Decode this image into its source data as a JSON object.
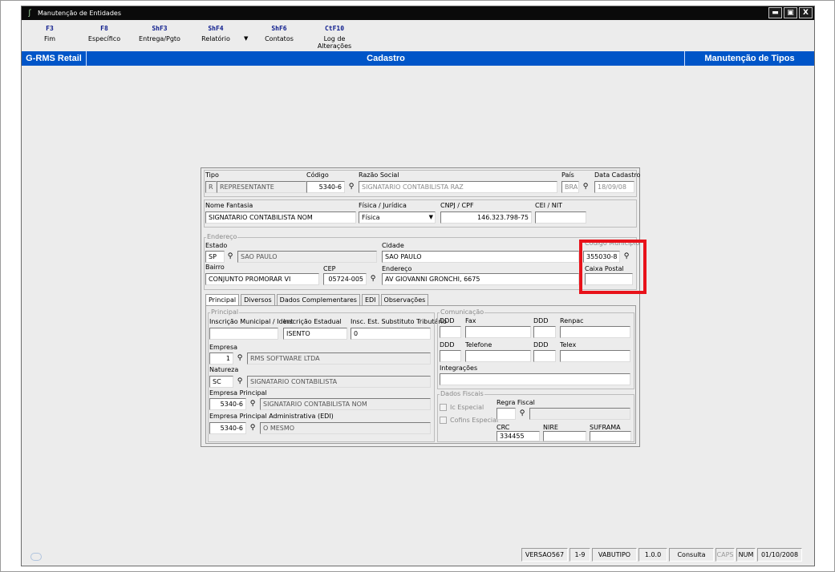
{
  "window": {
    "title": "Manutenção de Entidades",
    "buttons": {
      "minimize": "▬",
      "restore": "▣",
      "close": "X"
    }
  },
  "toolbar": [
    {
      "key": "F3",
      "label": "Fim"
    },
    {
      "key": "F8",
      "label": "Específico"
    },
    {
      "key": "ShF3",
      "label": "Entrega/Pgto"
    },
    {
      "key": "ShF4",
      "label": "Relatório"
    },
    {
      "key": "ShF6",
      "label": "Contatos"
    },
    {
      "key": "CtF10",
      "label": "Log de Alterações"
    }
  ],
  "header": {
    "left": "G-RMS Retail",
    "center": "Cadastro",
    "right": "Manutenção de Tipos"
  },
  "form": {
    "tipo": {
      "label": "Tipo",
      "code": "R",
      "value": "REPRESENTANTE"
    },
    "codigo": {
      "label": "Código",
      "value": "5340-6"
    },
    "razao_social": {
      "label": "Razão Social",
      "value": "SIGNATARIO CONTABILISTA RAZ"
    },
    "pais": {
      "label": "País",
      "value": "BRA"
    },
    "data_cadastro": {
      "label": "Data Cadastro",
      "value": "18/09/08"
    },
    "nome_fantasia": {
      "label": "Nome Fantasia",
      "value": "SIGNATARIO CONTABILISTA NOM"
    },
    "fisica_juridica": {
      "label": "Física / Jurídica",
      "value": "Física"
    },
    "cnpj_cpf": {
      "label": "CNPJ / CPF",
      "value": "146.323.798-75"
    },
    "cei_nit": {
      "label": "CEI / NIT",
      "value": ""
    },
    "endereco_group": "Endereço",
    "estado": {
      "label": "Estado",
      "code": "SP",
      "value": "SAO PAULO"
    },
    "cidade": {
      "label": "Cidade",
      "value": "SAO PAULO"
    },
    "codigo_municipio": {
      "label": "Código Municipio",
      "value": "355030-8"
    },
    "bairro": {
      "label": "Bairro",
      "value": "CONJUNTO PROMORAR VI"
    },
    "cep": {
      "label": "CEP",
      "value": "05724-005"
    },
    "endereco": {
      "label": "Endereço",
      "value": "AV GIOVANNI GRONCHI, 6675"
    },
    "caixa_postal": {
      "label": "Caixa Postal",
      "value": ""
    }
  },
  "tabs": [
    "Principal",
    "Diversos",
    "Dados Complementares",
    "EDI",
    "Observações"
  ],
  "principal": {
    "group": "Principal",
    "inscricao_municipal": {
      "label": "Inscrição Municipal / Ident",
      "value": ""
    },
    "inscricao_estadual": {
      "label": "Inscrição Estadual",
      "value": "ISENTO"
    },
    "insc_est_substituto": {
      "label": "Insc. Est. Substituto Tributário",
      "value": "0"
    },
    "empresa": {
      "label": "Empresa",
      "code": "1",
      "value": "RMS SOFTWARE LTDA"
    },
    "natureza": {
      "label": "Natureza",
      "code": "SC",
      "value": "SIGNATARIO CONTABILISTA"
    },
    "empresa_principal": {
      "label": "Empresa Principal",
      "code": "5340-6",
      "value": "SIGNATARIO CONTABILISTA NOM"
    },
    "empresa_principal_adm": {
      "label": "Empresa Principal Administrativa (EDI)",
      "code": "5340-6",
      "value": "O MESMO"
    }
  },
  "comunicacao": {
    "group": "Comunicação",
    "ddd": "DDD",
    "fax": "Fax",
    "renpac": "Renpac",
    "telefone": "Telefone",
    "telex": "Telex",
    "integracoes": "Integrações"
  },
  "dados_fiscais": {
    "group": "Dados Fiscais",
    "ic_especial": "Ic Especial",
    "cofins_especial": "Cofins Especial",
    "regra_fiscal": {
      "label": "Regra Fiscal",
      "value": ""
    },
    "crc": {
      "label": "CRC",
      "value": "334455"
    },
    "nire": {
      "label": "NIRE",
      "value": ""
    },
    "suframa": {
      "label": "SUFRAMA",
      "value": ""
    }
  },
  "statusbar": [
    "VERSAO567",
    "1-9",
    "VABUTIPO",
    "1.0.0",
    "Consulta",
    "CAPS",
    "NUM",
    "01/10/2008"
  ],
  "colors": {
    "accent": "#0055c8",
    "highlight": "#e8121a",
    "toolbar_key": "#0b1a8c"
  }
}
